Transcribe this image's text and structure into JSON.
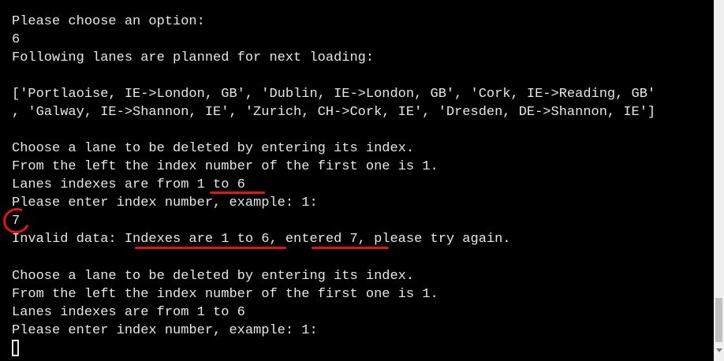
{
  "terminal": {
    "lines": [
      "-----------------------------",
      "Please choose an option:",
      "6",
      "Following lanes are planned for next loading:",
      "",
      "['Portlaoise, IE->London, GB', 'Dublin, IE->London, GB', 'Cork, IE->Reading, GB'",
      ", 'Galway, IE->Shannon, IE', 'Zurich, CH->Cork, IE', 'Dresden, DE->Shannon, IE']",
      "",
      "Choose a lane to be deleted by entering its index.",
      "From the left the index number of the first one is 1.",
      "Lanes indexes are from 1 to 6",
      "Please enter index number, example: 1:",
      "7",
      "Invalid data: Indexes are 1 to 6, entered 7, please try again.",
      "",
      "Choose a lane to be deleted by entering its index.",
      "From the left the index number of the first one is 1.",
      "Lanes indexes are from 1 to 6",
      "Please enter index number, example: 1:"
    ],
    "annotation_color": "#e3131b",
    "cursor_icon": "block-cursor"
  }
}
